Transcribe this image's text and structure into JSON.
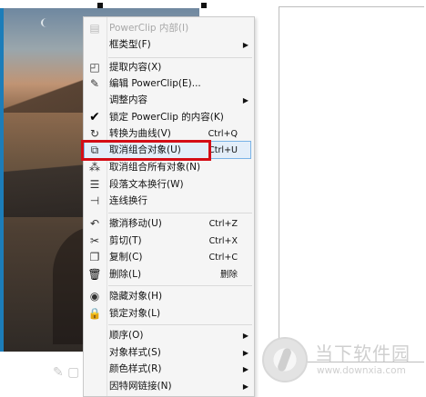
{
  "menu": {
    "items": [
      {
        "icon": "powerclip-inner-icon",
        "label": "PowerClip 内部(I)",
        "shortcut": "",
        "has_submenu": false,
        "disabled": true
      },
      {
        "icon": "",
        "label": "框类型(F)",
        "shortcut": "",
        "has_submenu": true
      },
      {
        "icon": "extract-content-icon",
        "label": "提取内容(X)",
        "shortcut": "",
        "has_submenu": false
      },
      {
        "icon": "edit-powerclip-icon",
        "label": "编辑 PowerClip(E)...",
        "shortcut": "",
        "has_submenu": false
      },
      {
        "icon": "",
        "label": "调整内容",
        "shortcut": "",
        "has_submenu": true
      },
      {
        "icon": "checkmark-icon",
        "label": "锁定 PowerClip 的内容(K)",
        "shortcut": "",
        "has_submenu": false
      },
      {
        "icon": "convert-curve-icon",
        "label": "转换为曲线(V)",
        "shortcut": "Ctrl+Q",
        "has_submenu": false
      },
      {
        "icon": "ungroup-icon",
        "label": "取消组合对象(U)",
        "shortcut": "Ctrl+U",
        "has_submenu": false
      },
      {
        "icon": "ungroup-all-icon",
        "label": "取消组合所有对象(N)",
        "shortcut": "",
        "has_submenu": false
      },
      {
        "icon": "paragraph-wrap-icon",
        "label": "段落文本换行(W)",
        "shortcut": "",
        "has_submenu": false
      },
      {
        "icon": "connect-wrap-icon",
        "label": "连线换行",
        "shortcut": "",
        "has_submenu": false
      },
      {
        "icon": "undo-icon",
        "label": "撤消移动(U)",
        "shortcut": "Ctrl+Z",
        "has_submenu": false
      },
      {
        "icon": "cut-icon",
        "label": "剪切(T)",
        "shortcut": "Ctrl+X",
        "has_submenu": false
      },
      {
        "icon": "copy-icon",
        "label": "复制(C)",
        "shortcut": "Ctrl+C",
        "has_submenu": false
      },
      {
        "icon": "delete-icon",
        "label": "删除(L)",
        "shortcut": "删除",
        "has_submenu": false
      },
      {
        "icon": "hide-object-icon",
        "label": "隐藏对象(H)",
        "shortcut": "",
        "has_submenu": false
      },
      {
        "icon": "lock-icon",
        "label": "锁定对象(L)",
        "shortcut": "",
        "has_submenu": false
      },
      {
        "icon": "",
        "label": "顺序(O)",
        "shortcut": "",
        "has_submenu": true
      },
      {
        "icon": "",
        "label": "对象样式(S)",
        "shortcut": "",
        "has_submenu": true
      },
      {
        "icon": "",
        "label": "颜色样式(R)",
        "shortcut": "",
        "has_submenu": true
      },
      {
        "icon": "",
        "label": "因特网链接(N)",
        "shortcut": "",
        "has_submenu": true
      }
    ]
  },
  "watermark": {
    "name": "当下软件园",
    "url": "www.downxia.com"
  },
  "colors": {
    "highlight_border": "#79b2e6",
    "annotation_red": "#d40d16"
  }
}
